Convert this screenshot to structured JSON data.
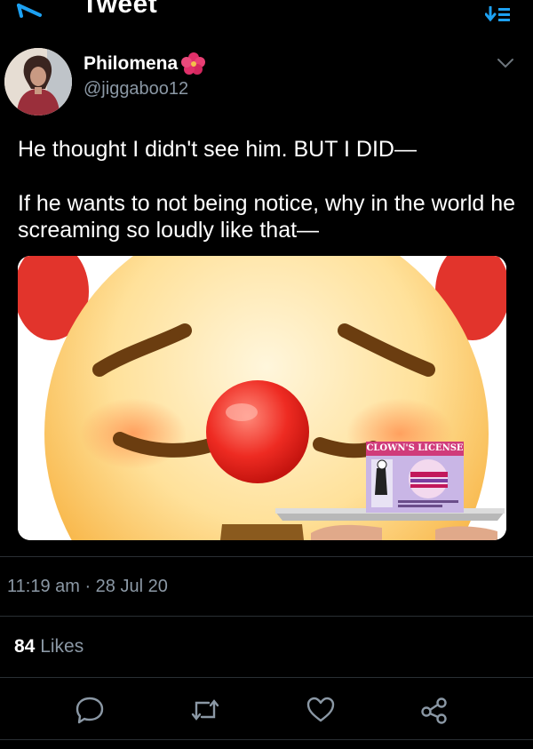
{
  "header": {
    "title": "Tweet",
    "back_icon": "arrow-left-icon",
    "sort_icon": "sort-icon",
    "accent_color": "#1da1f2"
  },
  "author": {
    "name": "Philomena",
    "handle": "@jiggaboo12",
    "name_emoji": "flower-icon",
    "more_icon": "chevron-down-icon"
  },
  "tweet": {
    "line1": "He thought I didn't see him. BUT I DID—",
    "line2": "If he wants to not being notice, why in the world he screaming so loudly like that—",
    "media": {
      "card_title": "CLOWN'S LICENSE"
    }
  },
  "meta": {
    "timestamp": "11:19 am · 28 Jul 20",
    "likes_count": "84",
    "likes_label": "Likes"
  },
  "actions": [
    "reply-icon",
    "retweet-icon",
    "like-icon",
    "share-icon"
  ],
  "colors": {
    "background": "#000000",
    "text": "#ffffff",
    "secondary_text": "#8b98a5",
    "divider": "#2a2f34"
  }
}
